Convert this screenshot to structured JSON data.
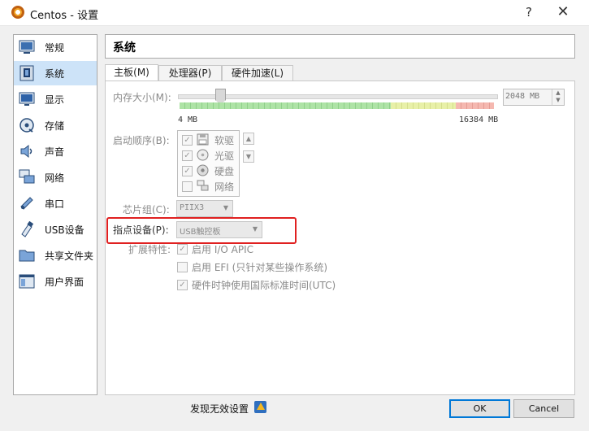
{
  "window": {
    "title": "Centos - 设置",
    "help": "?",
    "close": "✕"
  },
  "sidebar": {
    "items": [
      {
        "label": "常规",
        "icon": "general-icon"
      },
      {
        "label": "系统",
        "icon": "system-icon",
        "selected": true
      },
      {
        "label": "显示",
        "icon": "display-icon"
      },
      {
        "label": "存储",
        "icon": "storage-icon"
      },
      {
        "label": "声音",
        "icon": "audio-icon"
      },
      {
        "label": "网络",
        "icon": "network-icon"
      },
      {
        "label": "串口",
        "icon": "serial-port-icon"
      },
      {
        "label": "USB设备",
        "icon": "usb-icon"
      },
      {
        "label": "共享文件夹",
        "icon": "shared-folder-icon"
      },
      {
        "label": "用户界面",
        "icon": "user-interface-icon"
      }
    ]
  },
  "section_title": "系统",
  "tabs": [
    {
      "label": "主板(M)",
      "active": true
    },
    {
      "label": "处理器(P)",
      "active": false
    },
    {
      "label": "硬件加速(L)",
      "active": false
    }
  ],
  "motherboard": {
    "memory": {
      "label": "内存大小(M):",
      "value": "2048 MB",
      "min_label": "4 MB",
      "max_label": "16384 MB",
      "value_mb": 2048,
      "min_mb": 4,
      "max_mb": 16384
    },
    "boot_order": {
      "label": "启动顺序(B):",
      "devices": [
        {
          "name": "软驱",
          "checked": true,
          "icon": "floppy-icon"
        },
        {
          "name": "光驱",
          "checked": true,
          "icon": "optical-disc-icon"
        },
        {
          "name": "硬盘",
          "checked": true,
          "icon": "hard-disk-icon"
        },
        {
          "name": "网络",
          "checked": false,
          "icon": "network-boot-icon"
        }
      ],
      "up": "▲",
      "down": "▼"
    },
    "chipset": {
      "label": "芯片组(C):",
      "value": "PIIX3"
    },
    "pointing_device": {
      "label": "指点设备(P):",
      "value": "USB触控板"
    },
    "features": {
      "label": "扩展特性:",
      "items": [
        {
          "text": "启用 I/O APIC",
          "checked": true
        },
        {
          "text": "启用 EFI (只针对某些操作系统)",
          "checked": false
        },
        {
          "text": "硬件时钟使用国际标准时间(UTC)",
          "checked": true
        }
      ]
    }
  },
  "footer": {
    "invalid_settings": "发现无效设置",
    "ok": "OK",
    "cancel": "Cancel"
  },
  "colors": {
    "selected_bg": "#cde3f8",
    "highlight_border": "#e02020",
    "default_button_border": "#0078d7"
  }
}
